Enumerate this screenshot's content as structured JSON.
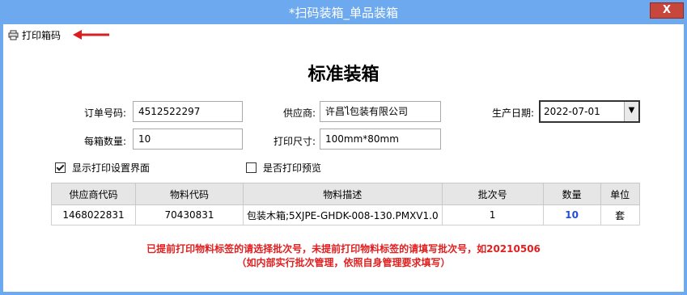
{
  "window": {
    "title": "*扫码装箱_单品装箱",
    "close_label": "X"
  },
  "toolbar": {
    "print_label": "打印箱码"
  },
  "page": {
    "heading": "标准装箱"
  },
  "form": {
    "order_no": {
      "label": "订单号码:",
      "value": "4512522297"
    },
    "supplier": {
      "label": "供应商:",
      "value": "许昌ไ包装有限公司"
    },
    "prod_date": {
      "label": "生产日期:",
      "value": "2022-07-01"
    },
    "per_box": {
      "label": "每箱数量:",
      "value": "10"
    },
    "print_size": {
      "label": "打印尺寸:",
      "value": "100mm*80mm"
    }
  },
  "options": {
    "show_print_settings": {
      "label": "显示打印设置界面",
      "checked": true
    },
    "print_preview": {
      "label": "是否打印预览",
      "checked": false
    }
  },
  "table": {
    "headers": [
      "供应商代码",
      "物料代码",
      "物料描述",
      "批次号",
      "数量",
      "单位"
    ],
    "rows": [
      [
        "1468022831",
        "70430831",
        "包装木箱;5XJPE-GHDK-008-130.PMXV1.0",
        "1",
        "10",
        "套"
      ]
    ]
  },
  "notes": {
    "line1": "已提前打印物料标签的请选择批次号，未提前打印物料标签的请填写批次号，如20210506",
    "line2": "（如内部实行批次管理，依照自身管理要求填写）"
  },
  "colors": {
    "titlebar": "#6ca9ee",
    "close": "#c7473c",
    "note": "#e02020",
    "qty": "#1f4fd6"
  }
}
